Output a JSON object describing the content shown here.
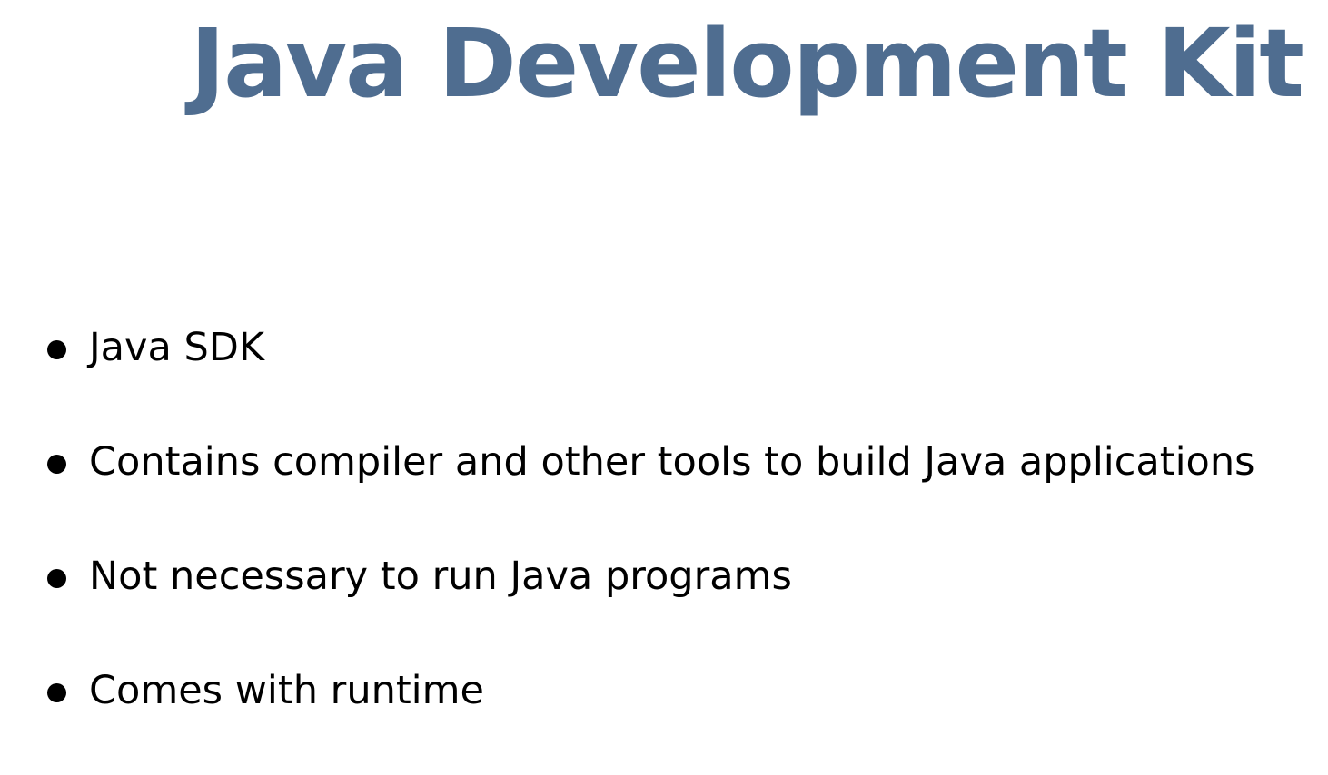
{
  "slide": {
    "title": "Java Development Kit",
    "title_color": "#4f6d90",
    "bullets": [
      {
        "text": "Java SDK"
      },
      {
        "text": "Contains compiler and other tools to build Java applications"
      },
      {
        "text": "Not necessary to run Java programs"
      },
      {
        "text": "Comes with runtime"
      }
    ]
  }
}
